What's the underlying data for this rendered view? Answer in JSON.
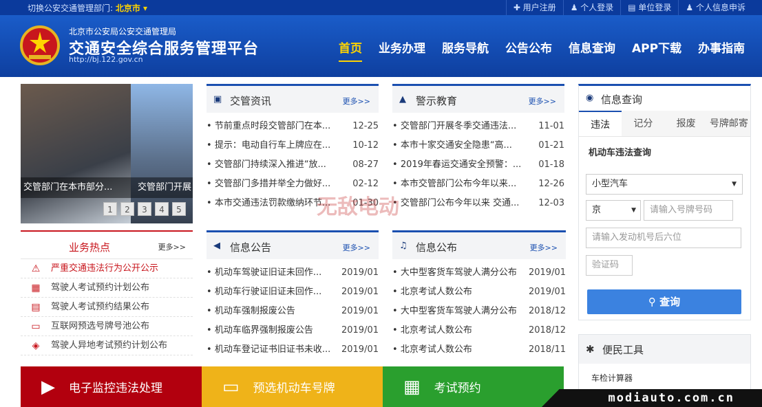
{
  "topbar": {
    "dept_label": "切换公安交通管理部门:",
    "city": "北京市 ▾",
    "links": [
      "✚ 用户注册",
      "♟ 个人登录",
      "▤ 单位登录",
      "♟ 个人信息申诉"
    ]
  },
  "header": {
    "org": "北京市公安局公安交通管理局",
    "title": "交通安全综合服务管理平台",
    "url": "http://bj.122.gov.cn",
    "nav": [
      "首页",
      "业务办理",
      "服务导航",
      "公告公布",
      "信息查询",
      "APP下载",
      "办事指南"
    ]
  },
  "carousel": {
    "captions": [
      "交管部门在本市部分...",
      "交管部门开展"
    ],
    "pages": [
      "1",
      "2",
      "3",
      "4",
      "5"
    ]
  },
  "news": {
    "title": "交管资讯",
    "more": "更多>>",
    "items": [
      {
        "t": "节前重点时段交管部门在本...",
        "d": "12-25"
      },
      {
        "t": "提示：电动自行车上牌应在...",
        "d": "10-12"
      },
      {
        "t": "交管部门持续深入推进“放...",
        "d": "08-27"
      },
      {
        "t": "交管部门多措并举全力做好...",
        "d": "02-12"
      },
      {
        "t": "本市交通违法罚款缴纳环节...",
        "d": "01-30"
      }
    ]
  },
  "warning": {
    "title": "警示教育",
    "more": "更多>>",
    "items": [
      {
        "t": "交管部门开展冬季交通违法...",
        "d": "11-01"
      },
      {
        "t": "本市十家交通安全隐患“高...",
        "d": "01-21"
      },
      {
        "t": "2019年春运交通安全预警：...",
        "d": "01-18"
      },
      {
        "t": "本市交管部门公布今年以来...",
        "d": "12-26"
      },
      {
        "t": "交管部门公布今年以来 交通...",
        "d": "12-03"
      }
    ]
  },
  "hot": {
    "title": "业务热点",
    "more": "更多>>",
    "items": [
      "严重交通违法行为公开公示",
      "驾驶人考试预约计划公布",
      "驾驶人考试预约结果公布",
      "互联网预选号牌号池公布",
      "驾驶人异地考试预约计划公布"
    ]
  },
  "notice": {
    "title": "信息公告",
    "more": "更多>>",
    "items": [
      {
        "t": "机动车驾驶证旧证未回作...",
        "d": "2019/01"
      },
      {
        "t": "机动车行驶证旧证未回作...",
        "d": "2019/01"
      },
      {
        "t": "机动车强制报废公告",
        "d": "2019/01"
      },
      {
        "t": "机动车临界强制报废公告",
        "d": "2019/01"
      },
      {
        "t": "机动车登记证书旧证书未收...",
        "d": "2019/01"
      }
    ]
  },
  "publish": {
    "title": "信息公布",
    "more": "更多>>",
    "items": [
      {
        "t": "大中型客货车驾驶人满分公布",
        "d": "2019/01"
      },
      {
        "t": "北京考试人数公布",
        "d": "2019/01"
      },
      {
        "t": "大中型客货车驾驶人满分公布",
        "d": "2018/12"
      },
      {
        "t": "北京考试人数公布",
        "d": "2018/12"
      },
      {
        "t": "北京考试人数公布",
        "d": "2018/11"
      }
    ]
  },
  "query": {
    "title": "信息查询",
    "tabs": [
      "违法",
      "记分",
      "报废",
      "号牌邮寄"
    ],
    "subtitle": "机动车违法查询",
    "vehicle_type": "小型汽车",
    "province": "京",
    "plate_ph": "请输入号牌号码",
    "engine_ph": "请输入发动机号后六位",
    "captcha_ph": "验证码",
    "button": "查询"
  },
  "tools": {
    "title": "便民工具",
    "items": [
      "车检计算器"
    ]
  },
  "tiles": [
    "电子监控违法处理",
    "预选机动车号牌",
    "考试预约"
  ],
  "watermark": "无敌电动",
  "corner": "modiauto.com.cn"
}
